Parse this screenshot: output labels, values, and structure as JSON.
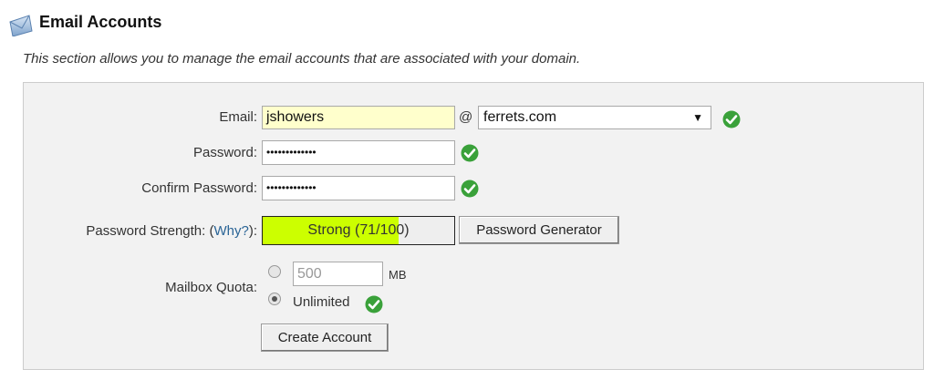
{
  "header": {
    "title": "Email Accounts",
    "icon": "mail-icon",
    "description": "This section allows you to manage the email accounts that are associated with your domain."
  },
  "form": {
    "email_label": "Email:",
    "email_value": "jshowers",
    "at_sign": "@",
    "domain_value": "ferrets.com",
    "password_label": "Password:",
    "password_value": "•••••••••••••",
    "confirm_label": "Confirm Password:",
    "confirm_value": "•••••••••••••",
    "strength_label_prefix": "Password Strength: (",
    "strength_why": "Why?",
    "strength_label_suffix": "):",
    "strength_text": "Strong (71/100)",
    "strength_value": 71,
    "strength_max": 100,
    "generator_button": "Password Generator",
    "quota_label": "Mailbox Quota:",
    "quota_value": "500",
    "quota_unit": "MB",
    "unlimited_label": "Unlimited",
    "create_button": "Create Account"
  },
  "colors": {
    "valid_check": "#3aa13a",
    "strength_fill": "#ccff00",
    "email_highlight": "#ffffcc",
    "link": "#2a6496"
  }
}
